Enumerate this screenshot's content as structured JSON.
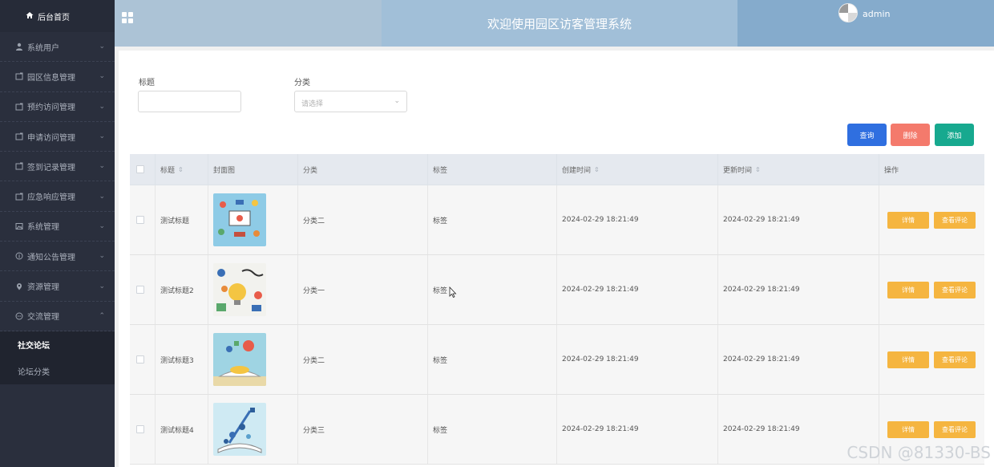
{
  "sidebar": {
    "home": "后台首页",
    "items": [
      {
        "label": "系统用户",
        "icon": "user-icon"
      },
      {
        "label": "园区信息管理",
        "icon": "folder-icon"
      },
      {
        "label": "预约访问管理",
        "icon": "folder-icon"
      },
      {
        "label": "申请访问管理",
        "icon": "folder-icon"
      },
      {
        "label": "签到记录管理",
        "icon": "folder-icon"
      },
      {
        "label": "应急响应管理",
        "icon": "folder-icon"
      },
      {
        "label": "系统管理",
        "icon": "image-icon"
      },
      {
        "label": "通知公告管理",
        "icon": "info-icon"
      },
      {
        "label": "资源管理",
        "icon": "location-icon"
      },
      {
        "label": "交流管理",
        "icon": "chat-icon"
      }
    ],
    "subitems": [
      {
        "label": "社交论坛",
        "active": true
      },
      {
        "label": "论坛分类",
        "active": false
      }
    ]
  },
  "header": {
    "title": "欢迎使用园区访客管理系统",
    "username": "admin"
  },
  "filters": {
    "title_label": "标题",
    "category_label": "分类",
    "category_placeholder": "请选择"
  },
  "buttons": {
    "query": "查询",
    "delete": "删除",
    "add": "添加"
  },
  "table": {
    "columns": [
      "标题",
      "封面图",
      "分类",
      "标签",
      "创建时间",
      "更新时间",
      "操作"
    ],
    "rows": [
      {
        "title": "测试标题",
        "category": "分类二",
        "tag": "标签",
        "created": "2024-02-29 18:21:49",
        "updated": "2024-02-29 18:21:49"
      },
      {
        "title": "测试标题2",
        "category": "分类一",
        "tag": "标签",
        "created": "2024-02-29 18:21:49",
        "updated": "2024-02-29 18:21:49"
      },
      {
        "title": "测试标题3",
        "category": "分类二",
        "tag": "标签",
        "created": "2024-02-29 18:21:49",
        "updated": "2024-02-29 18:21:49"
      },
      {
        "title": "测试标题4",
        "category": "分类三",
        "tag": "标签",
        "created": "2024-02-29 18:21:49",
        "updated": "2024-02-29 18:21:49"
      }
    ],
    "detail_label": "详情",
    "comment_label": "查看评论"
  },
  "watermark": "CSDN @81330-BS",
  "colors": {
    "sidebar_bg": "#2a2f3d",
    "query_btn": "#2f6fe0",
    "delete_btn": "#f47a6c",
    "add_btn": "#17a98f",
    "action_btn": "#f5b540"
  }
}
